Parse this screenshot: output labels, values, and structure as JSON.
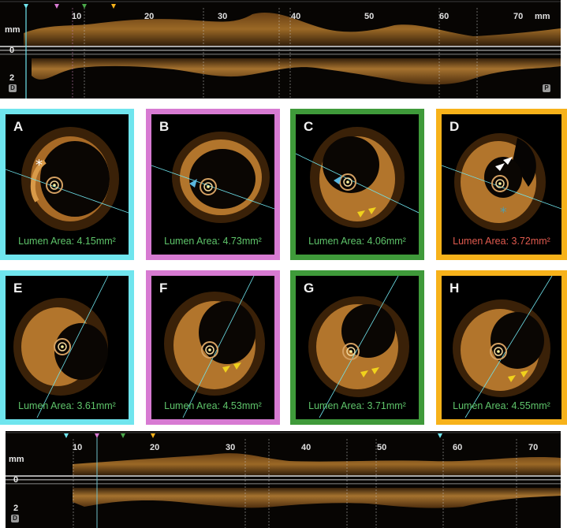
{
  "top_view": {
    "ticks": [
      "10",
      "20",
      "30",
      "40",
      "50",
      "60",
      "70"
    ],
    "unit": "mm",
    "axis_mm": "mm",
    "axis_zero": "0",
    "axis_two": "2",
    "left_badge": "D",
    "right_badge": "P"
  },
  "bottom_view": {
    "ticks": [
      "10",
      "20",
      "30",
      "40",
      "50",
      "60",
      "70"
    ],
    "axis_mm": "mm",
    "axis_zero": "0",
    "axis_two": "2",
    "left_badge": "D"
  },
  "colors": {
    "cyan": "#6fe5ee",
    "magenta": "#d77ad2",
    "green": "#3f9a3a",
    "orange": "#f7b21a",
    "area_green": "#5ec46a",
    "area_red": "#e05a4e"
  },
  "panels": [
    {
      "letter": "A",
      "area": "Lumen Area: 4.15mm²",
      "frame": "cyan"
    },
    {
      "letter": "B",
      "area": "Lumen Area: 4.73mm²",
      "frame": "magenta"
    },
    {
      "letter": "C",
      "area": "Lumen Area: 4.06mm²",
      "frame": "green"
    },
    {
      "letter": "D",
      "area": "Lumen Area: 3.72mm²",
      "frame": "orange"
    },
    {
      "letter": "E",
      "area": "Lumen Area: 3.61mm²",
      "frame": "cyan"
    },
    {
      "letter": "F",
      "area": "Lumen Area: 4.53mm²",
      "frame": "magenta"
    },
    {
      "letter": "G",
      "area": "Lumen Area: 3.71mm²",
      "frame": "green"
    },
    {
      "letter": "H",
      "area": "Lumen Area: 4.55mm²",
      "frame": "orange"
    }
  ]
}
